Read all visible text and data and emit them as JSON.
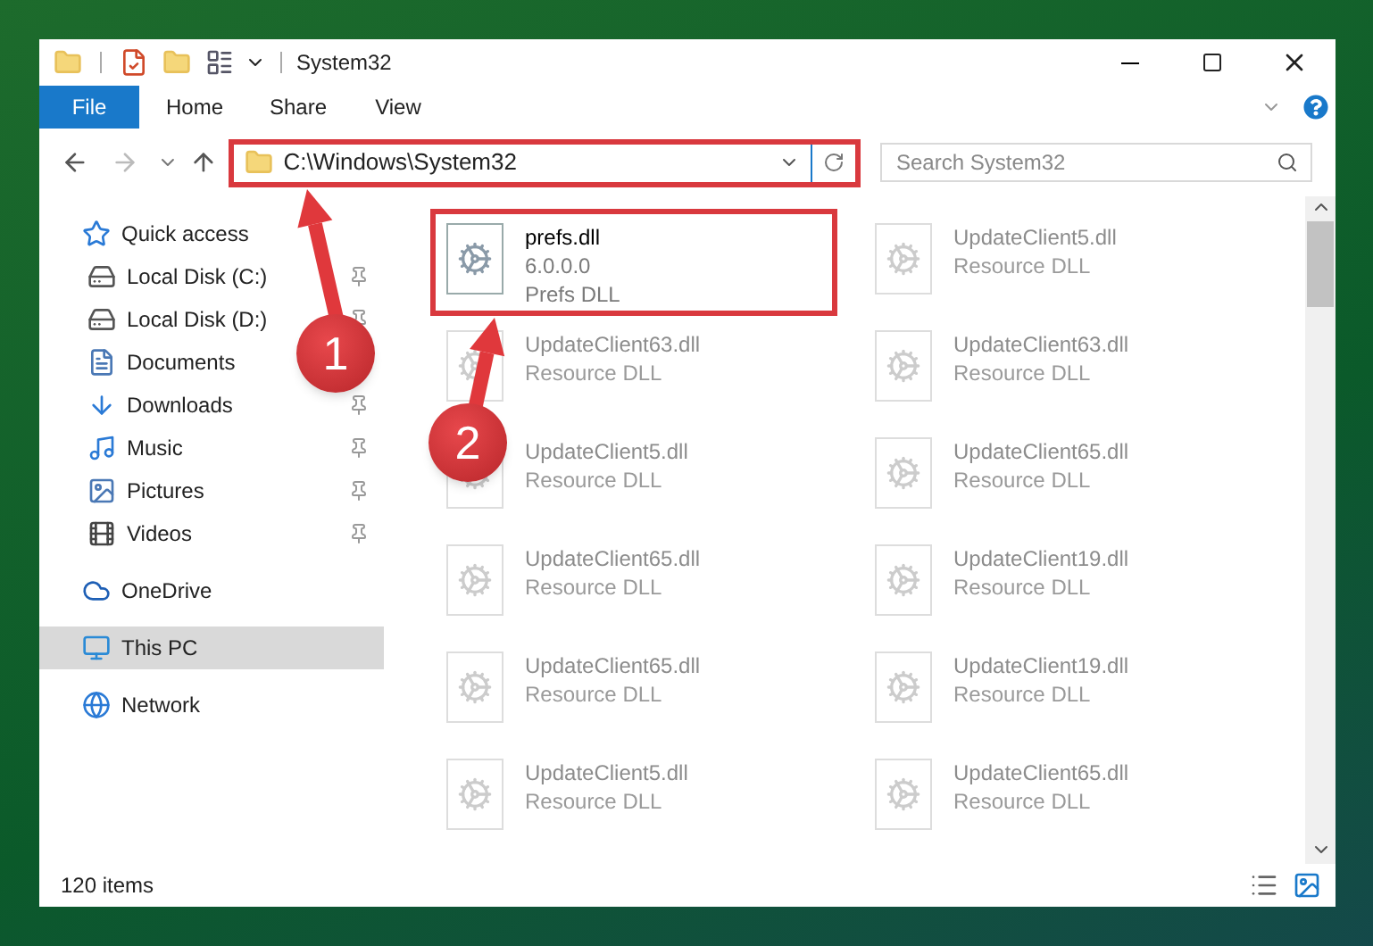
{
  "window": {
    "title": "System32"
  },
  "ribbon_tabs": [
    {
      "label": "File",
      "selected": true
    },
    {
      "label": "Home",
      "selected": false
    },
    {
      "label": "Share",
      "selected": false
    },
    {
      "label": "View",
      "selected": false
    }
  ],
  "address_bar": {
    "value": "C:\\Windows\\System32",
    "highlighted": true
  },
  "search": {
    "placeholder": "Search System32"
  },
  "sidebar": {
    "items": [
      {
        "label": "Quick access",
        "kind": "star",
        "selected": false,
        "children": [
          {
            "label": "Local Disk (C:)",
            "kind": "drive",
            "pinned": true
          },
          {
            "label": "Local Disk (D:)",
            "kind": "drive",
            "pinned": true
          },
          {
            "label": "Documents",
            "kind": "documents",
            "pinned": false
          },
          {
            "label": "Downloads",
            "kind": "downloads",
            "pinned": true
          },
          {
            "label": "Music",
            "kind": "music",
            "pinned": true
          },
          {
            "label": "Pictures",
            "kind": "pictures",
            "pinned": true
          },
          {
            "label": "Videos",
            "kind": "videos",
            "pinned": true
          }
        ]
      },
      {
        "label": "OneDrive",
        "kind": "cloud",
        "selected": false
      },
      {
        "label": "This PC",
        "kind": "pc",
        "selected": true
      },
      {
        "label": "Network",
        "kind": "network",
        "selected": false
      }
    ]
  },
  "files": [
    {
      "name": "prefs.dll",
      "version": "6.0.0.0",
      "description": "Prefs DLL",
      "blurred": false,
      "highlighted": true
    },
    {
      "name": "UpdateClient5.dll",
      "description": "Resource DLL",
      "blurred": true,
      "highlighted": false
    },
    {
      "name": "UpdateClient63.dll",
      "description": "Resource DLL",
      "blurred": true,
      "highlighted": false
    },
    {
      "name": "UpdateClient63.dll",
      "description": "Resource DLL",
      "blurred": true,
      "highlighted": false
    },
    {
      "name": "UpdateClient5.dll",
      "description": "Resource DLL",
      "blurred": true,
      "highlighted": false
    },
    {
      "name": "UpdateClient65.dll",
      "description": "Resource DLL",
      "blurred": true,
      "highlighted": false
    },
    {
      "name": "UpdateClient65.dll",
      "description": "Resource DLL",
      "blurred": true,
      "highlighted": false
    },
    {
      "name": "UpdateClient19.dll",
      "description": "Resource DLL",
      "blurred": true,
      "highlighted": false
    },
    {
      "name": "UpdateClient65.dll",
      "description": "Resource DLL",
      "blurred": true,
      "highlighted": false
    },
    {
      "name": "UpdateClient19.dll",
      "description": "Resource DLL",
      "blurred": true,
      "highlighted": false
    },
    {
      "name": "UpdateClient5.dll",
      "description": "Resource DLL",
      "blurred": true,
      "highlighted": false
    },
    {
      "name": "UpdateClient65.dll",
      "description": "Resource DLL",
      "blurred": true,
      "highlighted": false
    }
  ],
  "status_bar": {
    "item_count": "120 items"
  },
  "annotations": [
    {
      "label": "1"
    },
    {
      "label": "2"
    }
  ]
}
